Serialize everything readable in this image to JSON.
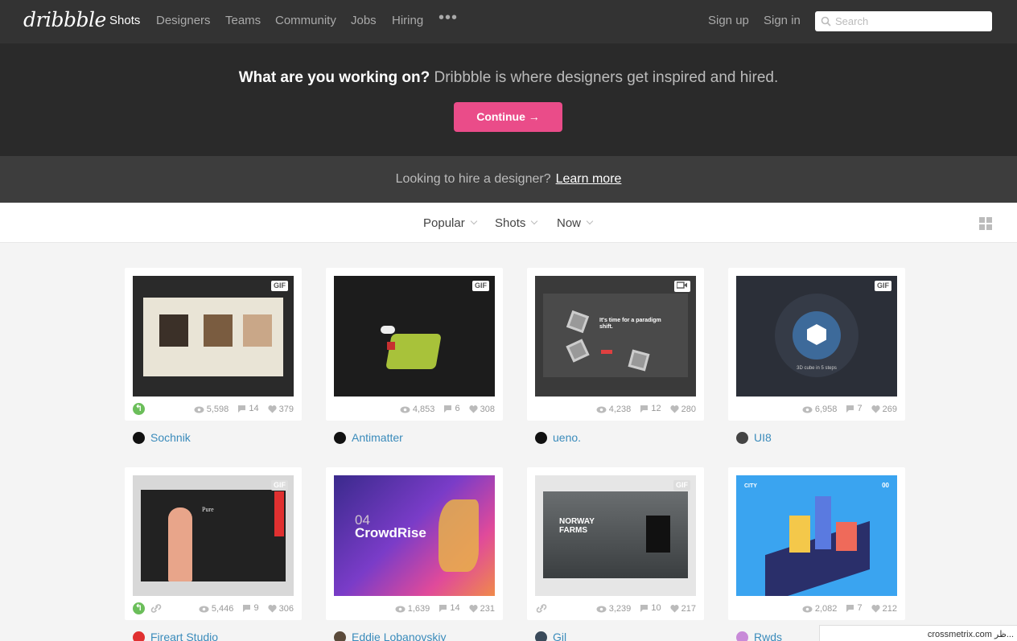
{
  "nav": {
    "logo": "dribbble",
    "links": [
      "Shots",
      "Designers",
      "Teams",
      "Community",
      "Jobs",
      "Hiring"
    ],
    "more": "•••",
    "signup": "Sign up",
    "signin": "Sign in",
    "search_placeholder": "Search"
  },
  "hero": {
    "question": "What are you working on?",
    "tagline": " Dribbble is where designers get inspired and hired.",
    "button": "Continue →"
  },
  "hire": {
    "text": "Looking to hire a designer?",
    "link": "Learn more"
  },
  "filters": [
    "Popular",
    "Shots",
    "Now"
  ],
  "shots": [
    {
      "author": "Sochnik",
      "views": "5,598",
      "comments": "14",
      "likes": "379",
      "badge": "GIF",
      "rebound": true,
      "link": false
    },
    {
      "author": "Antimatter",
      "views": "4,853",
      "comments": "6",
      "likes": "308",
      "badge": "GIF",
      "rebound": false,
      "link": false
    },
    {
      "author": "ueno.",
      "views": "4,238",
      "comments": "12",
      "likes": "280",
      "badge": "video-icon",
      "rebound": false,
      "link": false
    },
    {
      "author": "UI8",
      "views": "6,958",
      "comments": "7",
      "likes": "269",
      "badge": "GIF",
      "rebound": false,
      "link": false
    },
    {
      "author": "Fireart Studio",
      "views": "5,446",
      "comments": "9",
      "likes": "306",
      "badge": "GIF",
      "rebound": true,
      "link": true
    },
    {
      "author": "Eddie Lobanovskiy",
      "views": "1,639",
      "comments": "14",
      "likes": "231",
      "badge": "",
      "rebound": false,
      "link": false
    },
    {
      "author": "Gil",
      "views": "3,239",
      "comments": "10",
      "likes": "217",
      "badge": "GIF",
      "rebound": false,
      "link": true
    },
    {
      "author": "Rwds",
      "views": "2,082",
      "comments": "7",
      "likes": "212",
      "badge": "",
      "rebound": false,
      "link": false
    }
  ],
  "thumb_text": {
    "paradigm": "It's time for a paradigm shift.",
    "cube": "3D cube in 5 steps",
    "pure": "Pure",
    "crowd_num": "04",
    "crowd": "CrowdRise",
    "norway": "NORWAY FARMS",
    "city": "CITY",
    "city_num": "00"
  },
  "watermark": "crossmetrix.com ظر..."
}
